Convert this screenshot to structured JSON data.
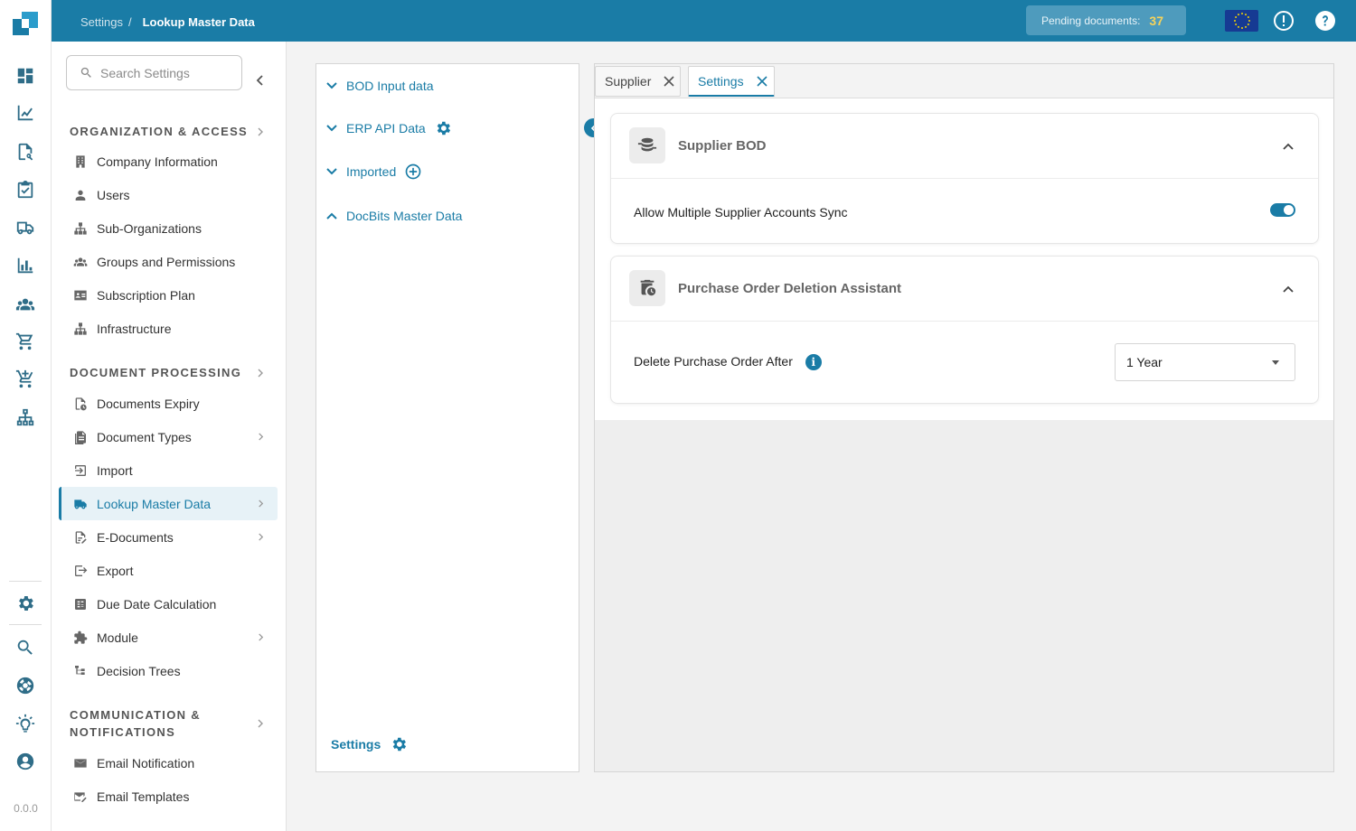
{
  "app": {
    "version": "0.0.0"
  },
  "topbar": {
    "breadcrumb": [
      "Settings",
      "/",
      "Lookup Master Data"
    ],
    "pending_label": "Pending documents:",
    "pending_count": "37",
    "flag": "eu-flag-icon"
  },
  "rail": {
    "icons": [
      "dashboard-icon",
      "analytics-icon",
      "document-search-icon",
      "task-icon",
      "delivery-icon",
      "bar-chart-icon",
      "team-icon",
      "cart-icon",
      "add-cart-icon",
      "network-icon",
      "settings-icon",
      "search-icon",
      "support-icon",
      "idea-icon",
      "account-icon"
    ]
  },
  "sidebar": {
    "search_placeholder": "Search Settings",
    "sections": [
      {
        "label": "ORGANIZATION & ACCESS"
      },
      {
        "label": "DOCUMENT PROCESSING"
      },
      {
        "label": "COMMUNICATION &",
        "label2": "NOTIFICATIONS"
      }
    ],
    "items": [
      {
        "label": "Company Information"
      },
      {
        "label": "Users"
      },
      {
        "label": "Sub-Organizations"
      },
      {
        "label": "Groups and Permissions"
      },
      {
        "label": "Subscription Plan"
      },
      {
        "label": "Infrastructure"
      },
      {
        "label": "Documents Expiry"
      },
      {
        "label": "Document Types"
      },
      {
        "label": "Import"
      },
      {
        "label": "Lookup Master Data",
        "active": true
      },
      {
        "label": "E-Documents"
      },
      {
        "label": "Export"
      },
      {
        "label": "Due Date Calculation"
      },
      {
        "label": "Module"
      },
      {
        "label": "Decision Trees"
      },
      {
        "label": "Email Notification"
      },
      {
        "label": "Email Templates"
      }
    ]
  },
  "tree": {
    "nodes": [
      {
        "label": "BOD Input data",
        "expanded": false
      },
      {
        "label": "ERP API Data",
        "expanded": false
      },
      {
        "label": "Imported",
        "expanded": false
      },
      {
        "label": "DocBits Master Data",
        "expanded": true
      }
    ],
    "footer_label": "Settings"
  },
  "main": {
    "tabs": [
      {
        "label": "Supplier",
        "active": false
      },
      {
        "label": "Settings",
        "active": true
      }
    ],
    "cards": [
      {
        "title": "Supplier BOD",
        "setting_label": "Allow Multiple Supplier Accounts Sync",
        "toggle_on": true
      },
      {
        "title": "Purchase Order Deletion Assistant",
        "setting_label": "Delete Purchase Order After",
        "info_glyph": "i",
        "select_value": "1 Year"
      }
    ]
  },
  "colors": {
    "accent": "#1a7ca6",
    "pending_count": "#f6d35a"
  }
}
